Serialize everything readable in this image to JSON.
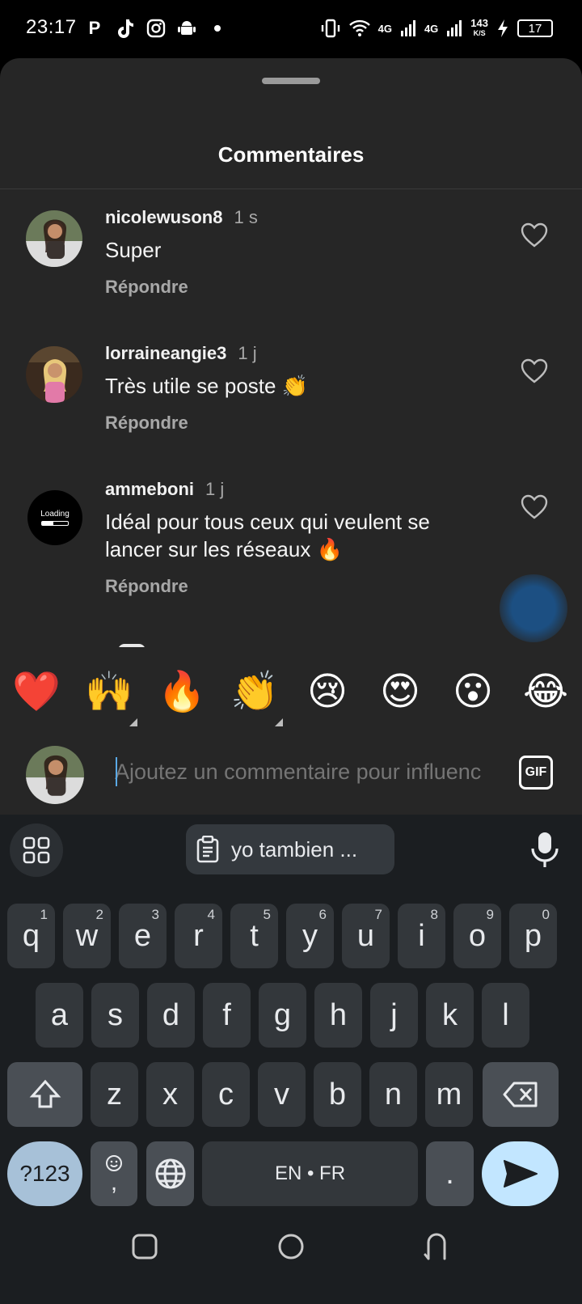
{
  "status_bar": {
    "time": "23:17",
    "left_icons": [
      "p-icon",
      "tiktok-icon",
      "instagram-icon",
      "android-icon",
      "dot-icon"
    ],
    "network_1": "4G",
    "network_2": "4G",
    "speed_value": "143",
    "speed_unit": "K/S",
    "battery": "17"
  },
  "comments_sheet": {
    "title": "Commentaires",
    "comments": [
      {
        "username": "nicolewuson8",
        "time": "1 s",
        "text": "Super",
        "reply_label": "Répondre"
      },
      {
        "username": "lorraineangie3",
        "time": "1 j",
        "text": "Très utile se poste 👏",
        "reply_label": "Répondre"
      },
      {
        "username": "ammeboni",
        "time": "1 j",
        "text": "Idéal pour tous ceux qui veulent se lancer sur les réseaux 🔥",
        "reply_label": "Répondre",
        "avatar_text": "Loading"
      }
    ]
  },
  "emoji_bar": [
    "❤️",
    "🙌",
    "🔥",
    "👏",
    "😢",
    "😍",
    "😮",
    "😂"
  ],
  "comment_input": {
    "placeholder": "Ajoutez un commentaire pour influenc",
    "gif_label": "GIF"
  },
  "keyboard": {
    "clipboard_suggestion": "yo tambien ...",
    "row1": [
      {
        "k": "q",
        "s": "1"
      },
      {
        "k": "w",
        "s": "2"
      },
      {
        "k": "e",
        "s": "3"
      },
      {
        "k": "r",
        "s": "4"
      },
      {
        "k": "t",
        "s": "5"
      },
      {
        "k": "y",
        "s": "6"
      },
      {
        "k": "u",
        "s": "7"
      },
      {
        "k": "i",
        "s": "8"
      },
      {
        "k": "o",
        "s": "9"
      },
      {
        "k": "p",
        "s": "0"
      }
    ],
    "row2": [
      "a",
      "s",
      "d",
      "f",
      "g",
      "h",
      "j",
      "k",
      "l"
    ],
    "row3": [
      "z",
      "x",
      "c",
      "v",
      "b",
      "n",
      "m"
    ],
    "symbols_key": "?123",
    "comma_key": ",",
    "space_label": "EN • FR",
    "period_key": "."
  },
  "colors": {
    "sheet_bg": "#262626",
    "keyboard_bg": "#1b1e21",
    "key_bg": "#33373b",
    "send_key_bg": "#c2e6ff",
    "symbols_key_bg": "#a7c1d8"
  }
}
